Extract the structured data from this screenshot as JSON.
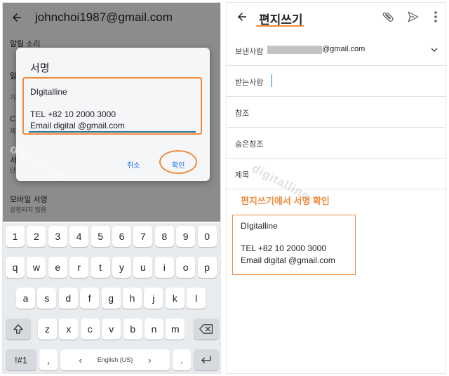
{
  "left_screen": {
    "settings": {
      "account": "johnchoi1987@gmail.com",
      "section_notification_sound": "알림 소리",
      "mobile_signature_label": "모바일 서명",
      "mobile_signature_value": "설정되지 않음"
    },
    "dialog": {
      "title": "서명",
      "signature_lines": [
        "DIgitalline",
        "",
        "TEL  +82 10 2000 3000",
        "Email  digital @gmail.com"
      ],
      "cancel": "취소",
      "confirm": "확인"
    },
    "watermark": "digitalline",
    "keyboard": {
      "row_numbers": [
        "1",
        "2",
        "3",
        "4",
        "5",
        "6",
        "7",
        "8",
        "9",
        "0"
      ],
      "row1": [
        "q",
        "w",
        "e",
        "r",
        "t",
        "y",
        "u",
        "i",
        "o",
        "p"
      ],
      "row2": [
        "a",
        "s",
        "d",
        "f",
        "g",
        "h",
        "j",
        "k",
        "l"
      ],
      "row3": [
        "z",
        "x",
        "c",
        "v",
        "b",
        "n",
        "m"
      ],
      "symbols": "!#1",
      "comma": ",",
      "period": ".",
      "left_arrow": "‹",
      "right_arrow": "›",
      "space_label": "English (US)"
    }
  },
  "right_screen": {
    "title": "편지쓰기",
    "from_label": "보낸사람",
    "from_suffix": "@gmail.com",
    "to_label": "받는사람",
    "cc_label": "참조",
    "bcc_label": "숨은참조",
    "subject_label": "제목",
    "caption": "편지쓰기에서 서명 확인",
    "signature_lines": [
      "DIgitalline",
      "",
      "TEL  +82 10 2000 3000",
      "Email  digital @gmail.com"
    ],
    "watermark": "digitalline"
  },
  "icons": [
    "back-arrow-icon",
    "attach-icon",
    "send-icon",
    "more-icon",
    "chevron-down-icon",
    "shift-icon",
    "backspace-icon",
    "enter-icon"
  ],
  "colors": {
    "accent_orange": "#f28b3d",
    "link_blue": "#1a73e8",
    "keyboard_bg": "#e9ecef"
  }
}
